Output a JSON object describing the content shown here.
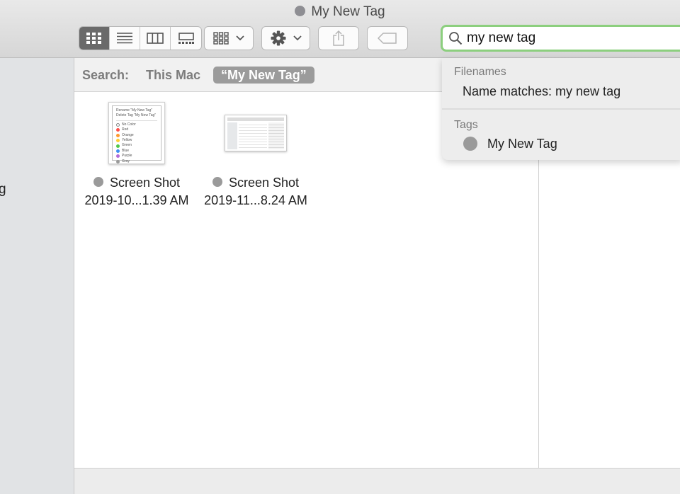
{
  "window": {
    "title": "My New Tag",
    "tag_color": "#8e8e93"
  },
  "toolbar": {
    "view_modes": [
      {
        "name": "icon-view",
        "icon": "grid-icon",
        "active": true
      },
      {
        "name": "list-view",
        "icon": "list-icon",
        "active": false
      },
      {
        "name": "column-view",
        "icon": "columns-icon",
        "active": false
      },
      {
        "name": "gallery-view",
        "icon": "gallery-icon",
        "active": false
      }
    ],
    "group_icon": "group-by-icon",
    "action_icon": "gear-icon",
    "share_icon": "share-icon",
    "tag_icon": "tag-icon"
  },
  "search": {
    "value": "my new tag",
    "focus_color": "#8ccf7e"
  },
  "sidebar": {
    "partial_label": "g"
  },
  "scope_bar": {
    "label": "Search:",
    "this_mac": "This Mac",
    "selected_scope": "“My New Tag”"
  },
  "files": [
    {
      "name": "Screen Shot",
      "date": "2019-10...1.39 AM"
    },
    {
      "name": "Screen Shot",
      "date": "2019-11...8.24 AM"
    }
  ],
  "thumbnail1": {
    "line1": "Rename “My New Tag”",
    "line2": "Delete Tag “My New Tag”",
    "colors": [
      {
        "label": "No Color",
        "hex": "#ffffff"
      },
      {
        "label": "Red",
        "hex": "#ff4f4a"
      },
      {
        "label": "Orange",
        "hex": "#ff9a2e"
      },
      {
        "label": "Yellow",
        "hex": "#ffcf33"
      },
      {
        "label": "Green",
        "hex": "#50c84b"
      },
      {
        "label": "Blue",
        "hex": "#3d8ff4"
      },
      {
        "label": "Purple",
        "hex": "#b36ad9"
      },
      {
        "label": "Gray",
        "hex": "#9a9a9a"
      }
    ]
  },
  "dropdown": {
    "filenames_header": "Filenames",
    "name_match": "Name matches: my new tag",
    "tags_header": "Tags",
    "tag_item": "My New Tag"
  }
}
